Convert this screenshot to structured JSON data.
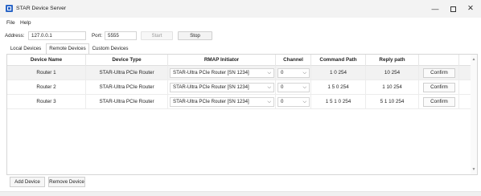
{
  "window": {
    "title": "STAR Device Server",
    "minimize": "—",
    "close": "✕"
  },
  "menu": [
    {
      "label": "File"
    },
    {
      "label": "Help"
    }
  ],
  "toolbar": {
    "address_label": "Address:",
    "address_value": "127.0.0.1",
    "port_label": "Port:",
    "port_value": "5555",
    "start_label": "Start",
    "stop_label": "Stop"
  },
  "tabs": [
    {
      "label": "Local Devices",
      "active": false
    },
    {
      "label": "Remote Devices",
      "active": true
    },
    {
      "label": "Custom Devices",
      "active": false
    }
  ],
  "table": {
    "headers": [
      "Device Name",
      "Device Type",
      "RMAP Initiator",
      "Channel",
      "Command Path",
      "Reply path"
    ],
    "rows": [
      {
        "name": "Router 1",
        "type": "STAR-Ultra PCIe Router",
        "initiator": "STAR-Ultra PCIe Router [SN 1234]",
        "channel": "0",
        "command_path": "1 0 254",
        "reply_path": "10 254",
        "action": "Confirm"
      },
      {
        "name": "Router 2",
        "type": "STAR-Ultra PCIe Router",
        "initiator": "STAR-Ultra PCIe Router [SN 1234]",
        "channel": "0",
        "command_path": "1 5 0 254",
        "reply_path": "1 10 254",
        "action": "Confirm"
      },
      {
        "name": "Router 3",
        "type": "STAR-Ultra PCIe Router",
        "initiator": "STAR-Ultra PCIe Router [SN 1234]",
        "channel": "0",
        "command_path": "1 5 1 0 254",
        "reply_path": "5 1 10 254",
        "action": "Confirm"
      }
    ]
  },
  "scroll": {
    "up": "▲",
    "down": "▼"
  },
  "combo_chevron": "⌵",
  "buttons": {
    "add_device": "Add Device",
    "remove_device": "Remove Device"
  }
}
